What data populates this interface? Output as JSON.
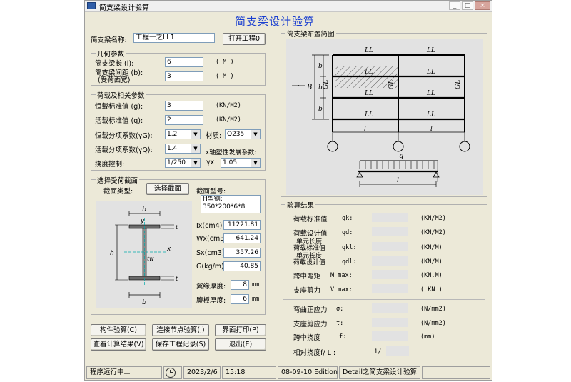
{
  "window": {
    "title": "简支梁设计验算",
    "heading": "简支梁设计验算",
    "controls": {
      "minimize": "_",
      "maximize": "□",
      "close": "×"
    }
  },
  "project": {
    "name_label": "简支梁名称:",
    "name_value": "工程一之LL1",
    "open_button": "打开工程0"
  },
  "geometry": {
    "caption": "几何参数",
    "length_label": "简支梁长 (l):",
    "length_value": "6",
    "length_unit": "( M )",
    "spacing_label_1": "简支梁间距 (b):",
    "spacing_label_2": "(受荷面宽)",
    "spacing_value": "3",
    "spacing_unit": "( M )"
  },
  "loads": {
    "caption": "荷载及相关参数",
    "dead_label": "恒载标准值 (g):",
    "dead_value": "3",
    "dead_unit": "(KN/M2)",
    "live_label": "活载标准值 (q):",
    "live_value": "2",
    "live_unit": "(KN/M2)",
    "gamma_g_label": "恒载分项系数(γG):",
    "gamma_g_value": "1.2",
    "material_label": "材质:",
    "material_value": "Q235",
    "gamma_q_label": "活载分项系数(γQ):",
    "gamma_q_value": "1.4",
    "plastic_label": "x轴塑性发展系数:",
    "deflection_label": "挠度控制:",
    "deflection_value": "1/250",
    "gamma_x_label": "γx",
    "gamma_x_value": "1.05"
  },
  "section": {
    "caption": "选择受荷截面",
    "type_label": "截面类型:",
    "select_button": "选择截面",
    "model_label": "截面型号:",
    "model_line1": "H型钢:",
    "model_line2": "350*200*6*8",
    "ix_label": "Ix(cm4):",
    "ix_value": "11221.81",
    "wx_label": "Wx(cm3):",
    "wx_value": "641.24",
    "sx_label": "Sx(cm3):",
    "sx_value": "357.26",
    "g_label": "G(kg/m):",
    "g_value": "40.85",
    "flange_label": "翼缘厚度:",
    "flange_value": "8",
    "flange_unit": "mm",
    "web_label": "腹板厚度:",
    "web_value": "6",
    "web_unit": "mm",
    "diagram": {
      "b_top": "b",
      "y_top": "y",
      "x_right": "x",
      "t_top": "t",
      "h": "h",
      "tw": "tw",
      "t_bot": "t",
      "b_bot": "b"
    }
  },
  "layout_plan": {
    "caption": "简支梁布置简图",
    "ll": "LL",
    "gl": "GL",
    "b": "b",
    "B": "B",
    "l": "l",
    "q": "q"
  },
  "results": {
    "caption": "验算结果",
    "rows": [
      {
        "label": "荷载标准值",
        "sym": "qk:",
        "unit": "(KN/M2)"
      },
      {
        "label": "荷载设计值",
        "sym": "qd:",
        "unit": "(KN/M2)"
      },
      {
        "label": "单元长度",
        "label2": "荷载标准值",
        "sym": "qkl:",
        "unit": "(KN/M)"
      },
      {
        "label": "单元长度",
        "label2": "荷载设计值",
        "sym": "qdl:",
        "unit": "(KN/M)"
      },
      {
        "label": "跨中弯矩",
        "sym": "M max:",
        "unit": "(KN.M)"
      },
      {
        "label": "支座剪力",
        "sym": "V max:",
        "unit": "( KN )"
      }
    ],
    "rows2": [
      {
        "label": "弯曲正应力",
        "sym": "σ:",
        "unit": "(N/mm2)"
      },
      {
        "label": "支座剪应力",
        "sym": "τ:",
        "unit": "(N/mm2)"
      },
      {
        "label": "跨中挠度",
        "sym": "f:",
        "unit": "(mm)"
      }
    ],
    "ratio_label": "相对挠度f/ L :",
    "ratio_prefix": "1/"
  },
  "buttons": {
    "check": "构件验算(C)",
    "node": "连接节点验算(J)",
    "print": "界面打印(P)",
    "view": "查看计算结果(V)",
    "save": "保存工程记录(S)",
    "exit": "退出(E)"
  },
  "status": {
    "running": "程序运行中...",
    "date": "2023/2/6",
    "time": "15:18",
    "version": "08-09-10 Edition",
    "module": "Detail之简支梁设计验算"
  }
}
